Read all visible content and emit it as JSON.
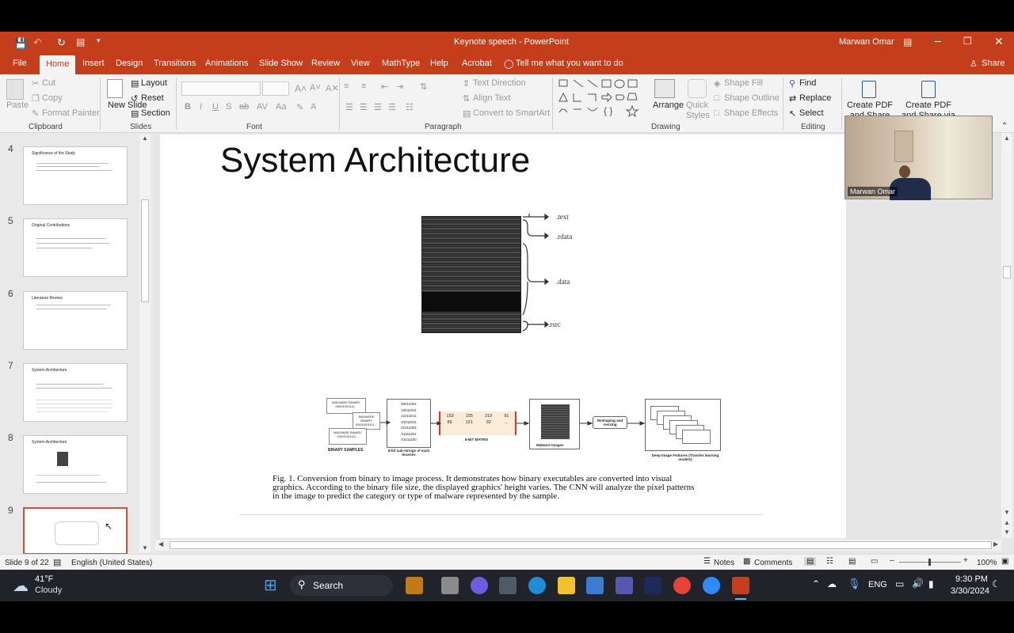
{
  "window": {
    "title": "Keynote speech  -  PowerPoint",
    "user": "Marwan Omar"
  },
  "tabs": [
    "File",
    "Home",
    "Insert",
    "Design",
    "Transitions",
    "Animations",
    "Slide Show",
    "Review",
    "View",
    "MathType",
    "Help",
    "Acrobat"
  ],
  "tell_me": "Tell me what you want to do",
  "share": "Share",
  "ribbon": {
    "clipboard": {
      "paste": "Paste",
      "cut": "Cut",
      "copy": "Copy",
      "format_painter": "Format Painter",
      "label": "Clipboard"
    },
    "slides": {
      "new_slide": "New Slide",
      "layout": "Layout",
      "reset": "Reset",
      "section": "Section",
      "label": "Slides"
    },
    "font": {
      "label": "Font"
    },
    "paragraph": {
      "text_direction": "Text Direction",
      "align_text": "Align Text",
      "convert": "Convert to SmartArt",
      "label": "Paragraph"
    },
    "drawing": {
      "arrange": "Arrange",
      "quick_styles": "Quick Styles",
      "shape_fill": "Shape Fill",
      "shape_outline": "Shape Outline",
      "shape_effects": "Shape Effects",
      "label": "Drawing"
    },
    "editing": {
      "find": "Find",
      "replace": "Replace",
      "select": "Select",
      "label": "Editing"
    },
    "acrobat": {
      "create_pdf": "Create PDF and Share link",
      "create_pdf_outlook": "Create PDF and Share via Outlook"
    }
  },
  "thumbnails": [
    {
      "num": "4",
      "title": "Significance of the Study"
    },
    {
      "num": "5",
      "title": "Original Contributions"
    },
    {
      "num": "6",
      "title": "Literature Review"
    },
    {
      "num": "7",
      "title": "System Architecture"
    },
    {
      "num": "8",
      "title": "System Architecture"
    },
    {
      "num": "9",
      "title": ""
    }
  ],
  "slide": {
    "title": "System Architecture",
    "sections": [
      ".text",
      ".rdata",
      ".data",
      ".rsrc"
    ],
    "diagram": {
      "binary1": "MALWARE BINARY 00001001111...",
      "binary2": "MALWARE BINARY 00001001111...",
      "binary3": "MALWARE BINARY 00001001111...",
      "binary_label": "BINARY SAMPLES",
      "substrings": [
        "00011001",
        "10011011",
        "11011011",
        "01011011",
        "01011001",
        "01111001",
        "01011100"
      ],
      "substrings_label": "8-bit sub-strings of each binaries",
      "matrix_row1": [
        "153",
        "155",
        "219",
        "91"
      ],
      "matrix_row2": [
        "89",
        "121",
        "92",
        "..."
      ],
      "matrix_label": "8-BIT MATRIX",
      "malware_label": "Malware Images",
      "reshape": "Reshaping and resizing",
      "features_label": "Deep Image Features (Transfer learning models)"
    },
    "caption": "Fig. 1.  Conversion from binary to image process. It demonstrates how binary executables are converted into visual graphics. According to the binary file size, the displayed graphics' height varies. The CNN will analyze the pixel patterns in the image to predict the category or type of malware represented by the sample."
  },
  "video": {
    "name": "Marwan Omar"
  },
  "status": {
    "slide": "Slide 9 of 22",
    "language": "English (United States)",
    "notes": "Notes",
    "comments": "Comments",
    "zoom": "100%"
  },
  "taskbar": {
    "temp": "41°F",
    "weather": "Cloudy",
    "search": "Search",
    "lang": "ENG",
    "time": "9:30 PM",
    "date": "3/30/2024"
  },
  "colors": {
    "accent": "#c43e1c",
    "taskbar": "#20232a"
  }
}
